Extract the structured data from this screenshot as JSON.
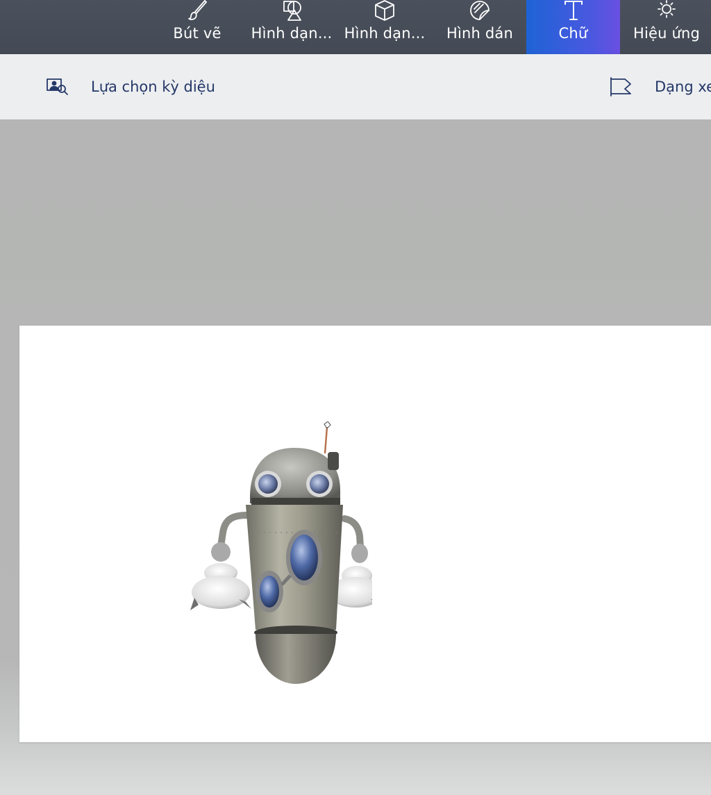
{
  "toolbar": {
    "tools": [
      {
        "label": "Bút vẽ",
        "icon": "brush-icon"
      },
      {
        "label": "Hình dạn...",
        "icon": "2d-shapes-icon"
      },
      {
        "label": "Hình dạn...",
        "icon": "3d-shapes-icon"
      },
      {
        "label": "Hình dán",
        "icon": "stickers-icon"
      },
      {
        "label": "Chữ",
        "icon": "text-icon",
        "active": true
      },
      {
        "label": "Hiệu ứng",
        "icon": "effects-icon"
      }
    ],
    "active_color": "#1e63d6"
  },
  "commandbar": {
    "magic_select": {
      "label": "Lựa chọn kỳ diệu",
      "icon": "magic-select-icon"
    },
    "view_mode": {
      "label": "Dạng xem",
      "icon": "view-flag-icon"
    }
  },
  "canvas": {
    "object": "robot-3d-model"
  }
}
